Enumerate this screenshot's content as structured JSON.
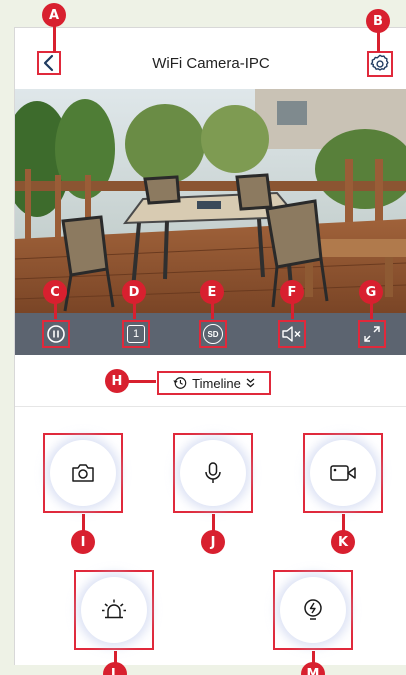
{
  "header": {
    "title": "WiFi Camera-IPC"
  },
  "controls": {
    "channel_label": "1",
    "quality_label": "SD"
  },
  "timeline": {
    "label": "Timeline"
  },
  "badges": {
    "a": "A",
    "b": "B",
    "c": "C",
    "d": "D",
    "e": "E",
    "f": "F",
    "g": "G",
    "h": "H",
    "i": "I",
    "j": "J",
    "k": "K",
    "l": "L",
    "m": "M"
  },
  "icons": {
    "back": "chevron-left-icon",
    "settings": "gear-icon",
    "pause": "pause-icon",
    "channel": "channel-one-icon",
    "quality": "sd-quality-icon",
    "mute": "speaker-mute-icon",
    "fullscreen": "fullscreen-icon",
    "timeline": "history-clock-icon",
    "snapshot": "camera-icon",
    "talk": "microphone-icon",
    "record": "video-camera-icon",
    "alarm": "siren-icon",
    "light": "bulb-icon"
  },
  "colors": {
    "annotation_red": "#e0293b",
    "control_bar": "#5c6470",
    "icon_dark": "#1f3a5f"
  }
}
